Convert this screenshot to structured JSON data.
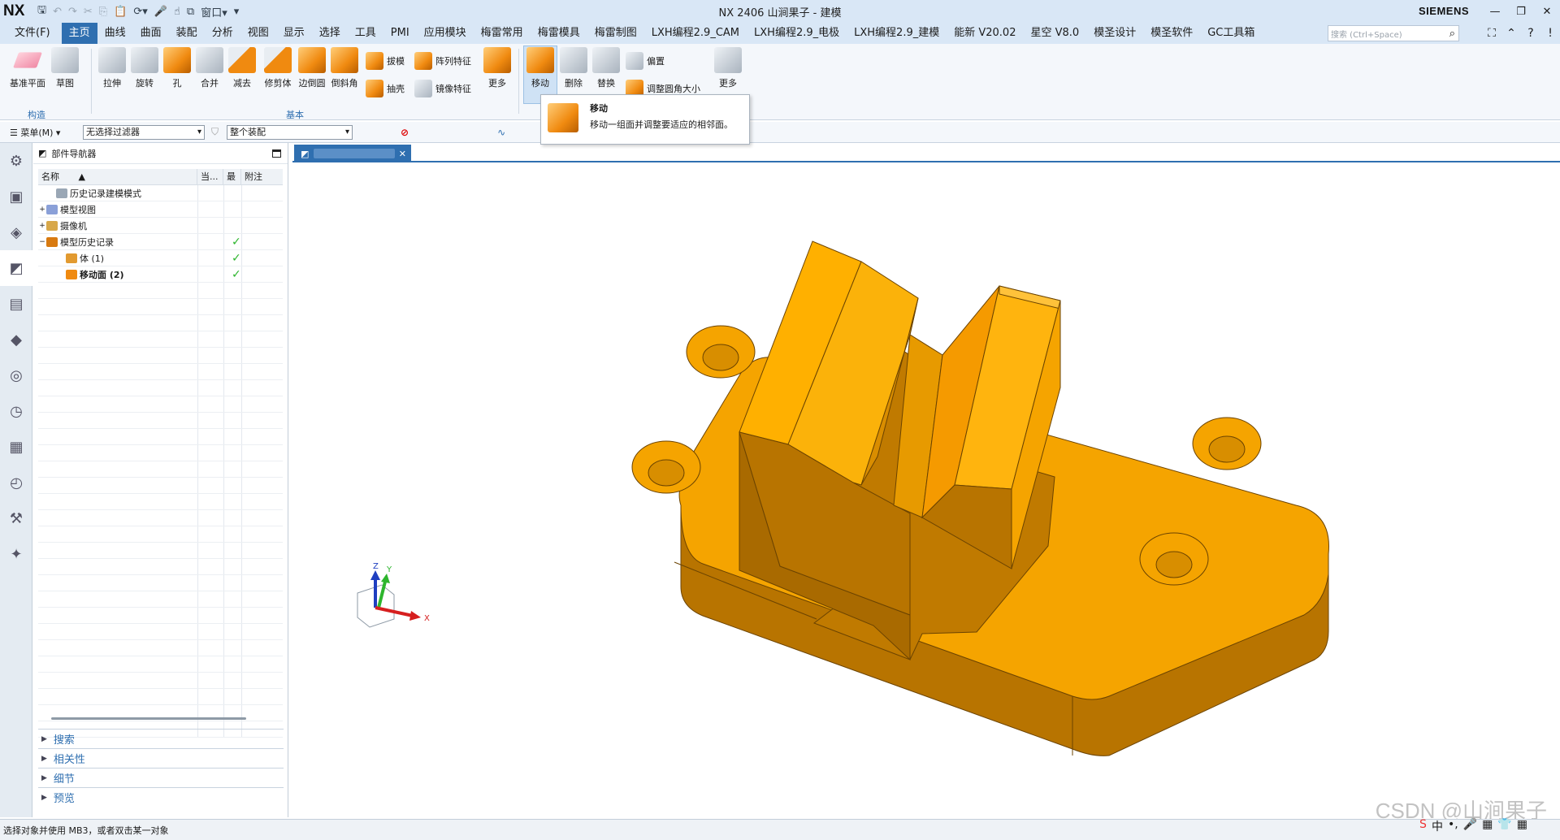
{
  "app": {
    "logo": "NX",
    "window_title": "NX 2406 山涧果子 - 建模",
    "brand": "SIEMENS",
    "window_menu": "窗口"
  },
  "menubar": {
    "file": "文件(F)",
    "items": [
      "主页",
      "曲线",
      "曲面",
      "装配",
      "分析",
      "视图",
      "显示",
      "选择",
      "工具",
      "PMI",
      "应用模块",
      "梅雷常用",
      "梅雷模具",
      "梅雷制图",
      "LXH编程2.9_CAM",
      "LXH编程2.9_电极",
      "LXH编程2.9_建模",
      "能新 V20.02",
      "星空 V8.0",
      "模圣设计",
      "模圣软件",
      "GC工具箱"
    ],
    "active_index": 0,
    "search_placeholder": "搜索 (Ctrl+Space)"
  },
  "ribbon": {
    "buttons": [
      "基准平面",
      "草图",
      "拉伸",
      "旋转",
      "孔",
      "合并",
      "减去",
      "修剪体",
      "边倒圆",
      "倒斜角",
      "更多",
      "移动",
      "删除",
      "替换",
      "更多"
    ],
    "small_buttons": [
      "拔模",
      "阵列特征",
      "抽壳",
      "镜像特征",
      "偏置",
      "调整圆角大小"
    ],
    "groups": [
      "构造",
      "基本"
    ]
  },
  "tooltip": {
    "title": "移动",
    "description": "移动一组面并调整要适应的相邻面。"
  },
  "toolbar2": {
    "menu_label": "菜单(M)",
    "filter": "无选择过滤器",
    "scope": "整个装配"
  },
  "navigator": {
    "title": "部件导航器",
    "columns": [
      "名称",
      "当...",
      "最",
      "附注"
    ],
    "rows": [
      {
        "label": "历史记录建模模式",
        "expand": "",
        "check": false,
        "bold": false
      },
      {
        "label": "模型视图",
        "expand": "+",
        "check": false,
        "bold": false
      },
      {
        "label": "摄像机",
        "expand": "+",
        "check": false,
        "bold": false
      },
      {
        "label": "模型历史记录",
        "expand": "−",
        "check": true,
        "bold": false
      },
      {
        "label": "体 (1)",
        "expand": "",
        "check": true,
        "bold": false
      },
      {
        "label": "移动面 (2)",
        "expand": "",
        "check": true,
        "bold": true
      }
    ]
  },
  "panels": [
    "搜索",
    "相关性",
    "细节",
    "预览"
  ],
  "triad": {
    "x": "X",
    "y": "Y",
    "z": "Z"
  },
  "status": "选择对象并使用 MB3，或者双击某一对象",
  "watermark": "CSDN @山涧果子",
  "colors": {
    "accent": "#2f6fb0",
    "part": "#f5a400",
    "part_dark": "#b87400",
    "check": "#2db52d"
  }
}
